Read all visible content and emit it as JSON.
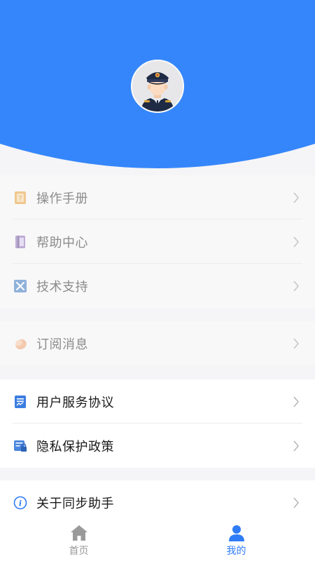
{
  "colors": {
    "header_blue": "#3586fb",
    "active_blue": "#2f7cf6",
    "inactive_gray": "#9a9a9a"
  },
  "profile": {
    "avatar_icon": "police-officer-avatar"
  },
  "menu_group_1": {
    "items": [
      {
        "label": "操作手册",
        "icon": "manual-book-icon"
      },
      {
        "label": "帮助中心",
        "icon": "help-book-icon"
      },
      {
        "label": "技术支持",
        "icon": "tools-icon"
      }
    ]
  },
  "menu_group_2": {
    "items": [
      {
        "label": "订阅消息",
        "icon": "subscribe-message-icon"
      }
    ]
  },
  "menu_group_3": {
    "items": [
      {
        "label": "用户服务协议",
        "icon": "agreement-document-icon"
      },
      {
        "label": "隐私保护政策",
        "icon": "privacy-lock-icon"
      }
    ]
  },
  "menu_group_4": {
    "items": [
      {
        "label": "关于同步助手",
        "icon": "info-icon"
      }
    ]
  },
  "tabbar": {
    "tabs": [
      {
        "label": "首页",
        "icon": "home-icon",
        "active": false
      },
      {
        "label": "我的",
        "icon": "person-icon",
        "active": true
      }
    ]
  }
}
